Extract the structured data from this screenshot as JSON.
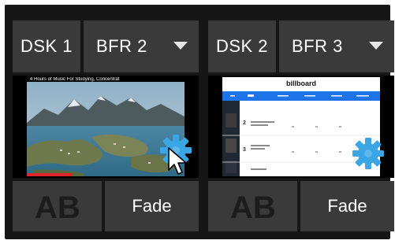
{
  "panels": [
    {
      "dsk_label": "DSK 1",
      "bfr_label": "BFR 2",
      "preview_title": "4 Hours of Music For Studying, Concentrat",
      "ab_text": "AB",
      "fade_label": "Fade"
    },
    {
      "dsk_label": "DSK 2",
      "bfr_label": "BFR 3",
      "preview_title": "billboard",
      "ab_text": "AB",
      "fade_label": "Fade"
    }
  ],
  "colors": {
    "panel_bg": "#161616",
    "button_bg": "#3a3a3a",
    "gear": "#3aa6e6",
    "billboard_blue": "#1e73e8"
  },
  "icons": [
    "dropdown-arrow-icon",
    "gear-icon",
    "mouse-cursor-icon",
    "ab-transition-icon"
  ]
}
